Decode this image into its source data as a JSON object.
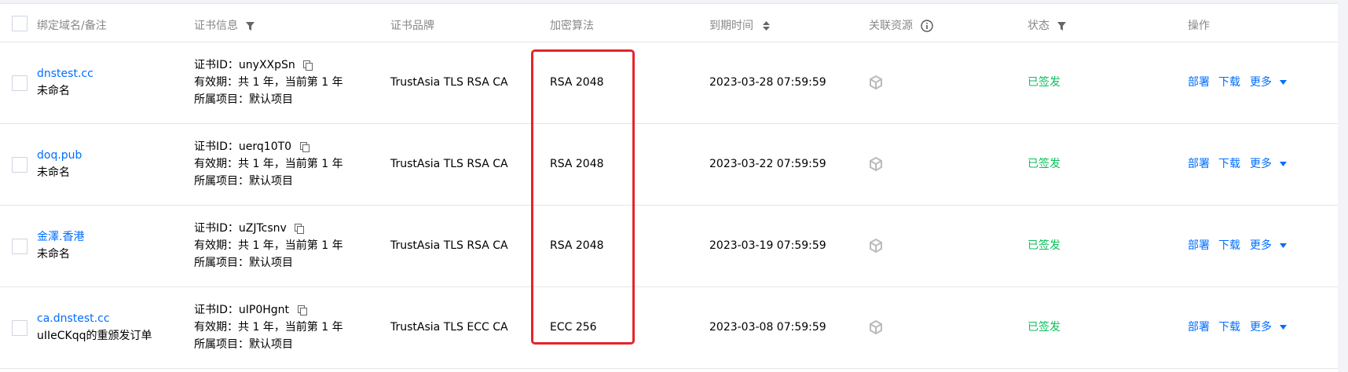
{
  "header": {
    "domain": "绑定域名/备注",
    "cert_info": "证书信息",
    "brand": "证书品牌",
    "algorithm": "加密算法",
    "expiry": "到期时间",
    "resources": "关联资源",
    "status": "状态",
    "actions": "操作"
  },
  "rows": [
    {
      "domain": "dnstest.cc",
      "note": "未命名",
      "cert_id": "证书ID：unyXXpSn",
      "validity": "有效期：共 1 年，当前第 1 年",
      "project": "所属项目：默认项目",
      "brand": "TrustAsia TLS RSA CA",
      "algorithm": "RSA 2048",
      "expiry": "2023-03-28 07:59:59",
      "status": "已签发",
      "deploy": "部署",
      "download": "下载",
      "more": "更多"
    },
    {
      "domain": "doq.pub",
      "note": "未命名",
      "cert_id": "证书ID：uerq10T0",
      "validity": "有效期：共 1 年，当前第 1 年",
      "project": "所属项目：默认项目",
      "brand": "TrustAsia TLS RSA CA",
      "algorithm": "RSA 2048",
      "expiry": "2023-03-22 07:59:59",
      "status": "已签发",
      "deploy": "部署",
      "download": "下载",
      "more": "更多"
    },
    {
      "domain": "金澤.香港",
      "note": "未命名",
      "cert_id": "证书ID：uZJTcsnv",
      "validity": "有效期：共 1 年，当前第 1 年",
      "project": "所属项目：默认项目",
      "brand": "TrustAsia TLS RSA CA",
      "algorithm": "RSA 2048",
      "expiry": "2023-03-19 07:59:59",
      "status": "已签发",
      "deploy": "部署",
      "download": "下载",
      "more": "更多"
    },
    {
      "domain": "ca.dnstest.cc",
      "note": "uIIeCKqq的重颁发订单",
      "cert_id": "证书ID：uIP0Hgnt",
      "validity": "有效期：共 1 年，当前第 1 年",
      "project": "所属项目：默认项目",
      "brand": "TrustAsia TLS ECC CA",
      "algorithm": "ECC 256",
      "expiry": "2023-03-08 07:59:59",
      "status": "已签发",
      "deploy": "部署",
      "download": "下载",
      "more": "更多"
    }
  ],
  "icons": {
    "filter": "filter-icon",
    "sort": "sort-icon",
    "info": "info-icon",
    "copy": "copy-icon",
    "resource": "cube-icon",
    "dropdown": "caret-down-icon"
  },
  "colors": {
    "link": "#006eff",
    "status_ok": "#0abf5b",
    "highlight": "#e5252a"
  }
}
